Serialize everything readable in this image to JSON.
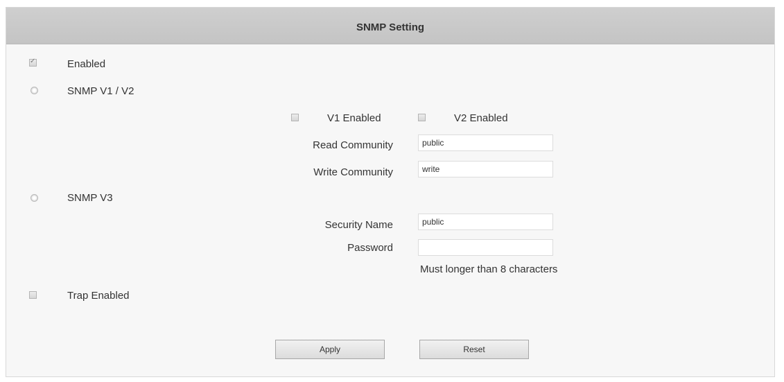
{
  "header": {
    "title": "SNMP Setting"
  },
  "enabled": {
    "label": "Enabled",
    "checked": true
  },
  "snmp_v1v2": {
    "label": "SNMP V1 / V2",
    "v1_label": "V1 Enabled",
    "v2_label": "V2 Enabled",
    "read_community_label": "Read Community",
    "read_community_value": "public",
    "write_community_label": "Write Community",
    "write_community_value": "write"
  },
  "snmp_v3": {
    "label": "SNMP V3",
    "security_name_label": "Security Name",
    "security_name_value": "public",
    "password_label": "Password",
    "password_value": "",
    "password_hint": "Must longer than 8 characters"
  },
  "trap": {
    "label": "Trap Enabled"
  },
  "actions": {
    "apply": "Apply",
    "reset": "Reset"
  }
}
